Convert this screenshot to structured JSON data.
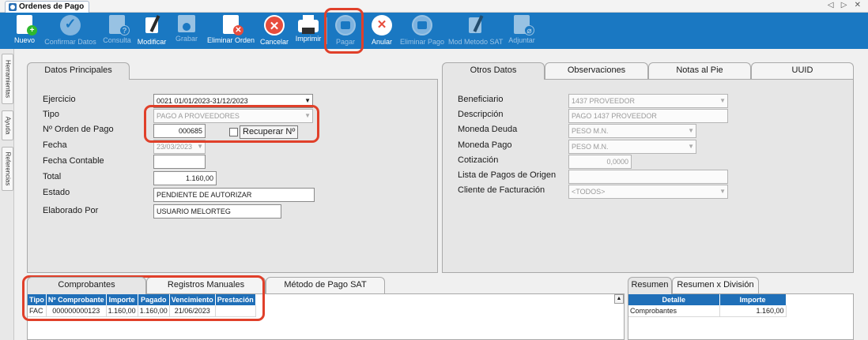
{
  "window": {
    "tab_title": "Ordenes de Pago",
    "controls": "◁ ▷ ✕"
  },
  "toolbar": {
    "items": [
      {
        "label": "Nuevo",
        "icon": "new-document-icon",
        "enabled": true
      },
      {
        "label": "Confirmar Datos",
        "icon": "check-icon",
        "enabled": false
      },
      {
        "label": "Consulta",
        "icon": "query-document-icon",
        "enabled": false
      },
      {
        "label": "Modificar",
        "icon": "edit-icon",
        "enabled": true
      },
      {
        "label": "Grabar",
        "icon": "save-disk-icon",
        "enabled": false
      },
      {
        "label": "Eliminar Orden",
        "icon": "delete-document-icon",
        "enabled": true
      },
      {
        "label": "Cancelar",
        "icon": "cancel-x-icon",
        "enabled": true
      },
      {
        "label": "Imprimir",
        "icon": "printer-icon",
        "enabled": true
      },
      {
        "label": "Pagar",
        "icon": "pay-icon",
        "enabled": false
      },
      {
        "label": "Anular",
        "icon": "void-x-icon",
        "enabled": true
      },
      {
        "label": "Eliminar Pago",
        "icon": "delete-payment-icon",
        "enabled": false
      },
      {
        "label": "Mod Metodo SAT",
        "icon": "edit-sat-icon",
        "enabled": false
      },
      {
        "label": "Adjuntar",
        "icon": "attach-document-icon",
        "enabled": false
      }
    ]
  },
  "side_tabs": [
    "Herramientas",
    "Ayuda",
    "Referencias"
  ],
  "datos_principales": {
    "tab_label": "Datos Principales",
    "ejercicio_label": "Ejercicio",
    "ejercicio_value": "0021 01/01/2023-31/12/2023",
    "tipo_label": "Tipo",
    "tipo_value": "PAGO A PROVEEDORES",
    "orden_label": "Nº Orden de Pago",
    "orden_value": "000685",
    "recuperar_label": "Recuperar Nº",
    "fecha_label": "Fecha",
    "fecha_value": "23/03/2023",
    "fecha_contable_label": "Fecha Contable",
    "fecha_contable_value": "",
    "total_label": "Total",
    "total_value": "1.160,00",
    "estado_label": "Estado",
    "estado_value": "PENDIENTE DE AUTORIZAR",
    "elaborado_label": "Elaborado Por",
    "elaborado_value": "USUARIO MELORTEG"
  },
  "otros_datos": {
    "tabs": [
      "Otros Datos",
      "Observaciones",
      "Notas al Pie",
      "UUID"
    ],
    "beneficiario_label": "Beneficiario",
    "beneficiario_value": "1437 PROVEEDOR",
    "descripcion_label": "Descripción",
    "descripcion_value": "PAGO 1437 PROVEEDOR",
    "moneda_deuda_label": "Moneda Deuda",
    "moneda_deuda_value": "PESO M.N.",
    "moneda_pago_label": "Moneda Pago",
    "moneda_pago_value": "PESO M.N.",
    "cotizacion_label": "Cotización",
    "cotizacion_value": "0,0000",
    "lista_pagos_label": "Lista de Pagos de Origen",
    "lista_pagos_value": "",
    "cliente_label": "Cliente de Facturación",
    "cliente_value": "<TODOS>"
  },
  "comprobantes": {
    "tabs": [
      "Comprobantes",
      "Registros Manuales",
      "Método de Pago SAT"
    ],
    "columns": [
      "Tipo",
      "Nº Comprobante",
      "Importe",
      "Pagado",
      "Vencimiento",
      "Prestación"
    ],
    "rows": [
      [
        "FAC",
        "000000000123",
        "1.160,00",
        "1.160,00",
        "21/06/2023",
        ""
      ]
    ]
  },
  "resumen": {
    "tabs": [
      "Resumen",
      "Resumen x División"
    ],
    "columns": [
      "Detalle",
      "Importe"
    ],
    "rows": [
      [
        "Comprobantes",
        "1.160,00"
      ]
    ]
  },
  "colors": {
    "toolbar": "#1a78c2",
    "grid_header": "#1f6fb8",
    "highlight": "#e0402a"
  }
}
